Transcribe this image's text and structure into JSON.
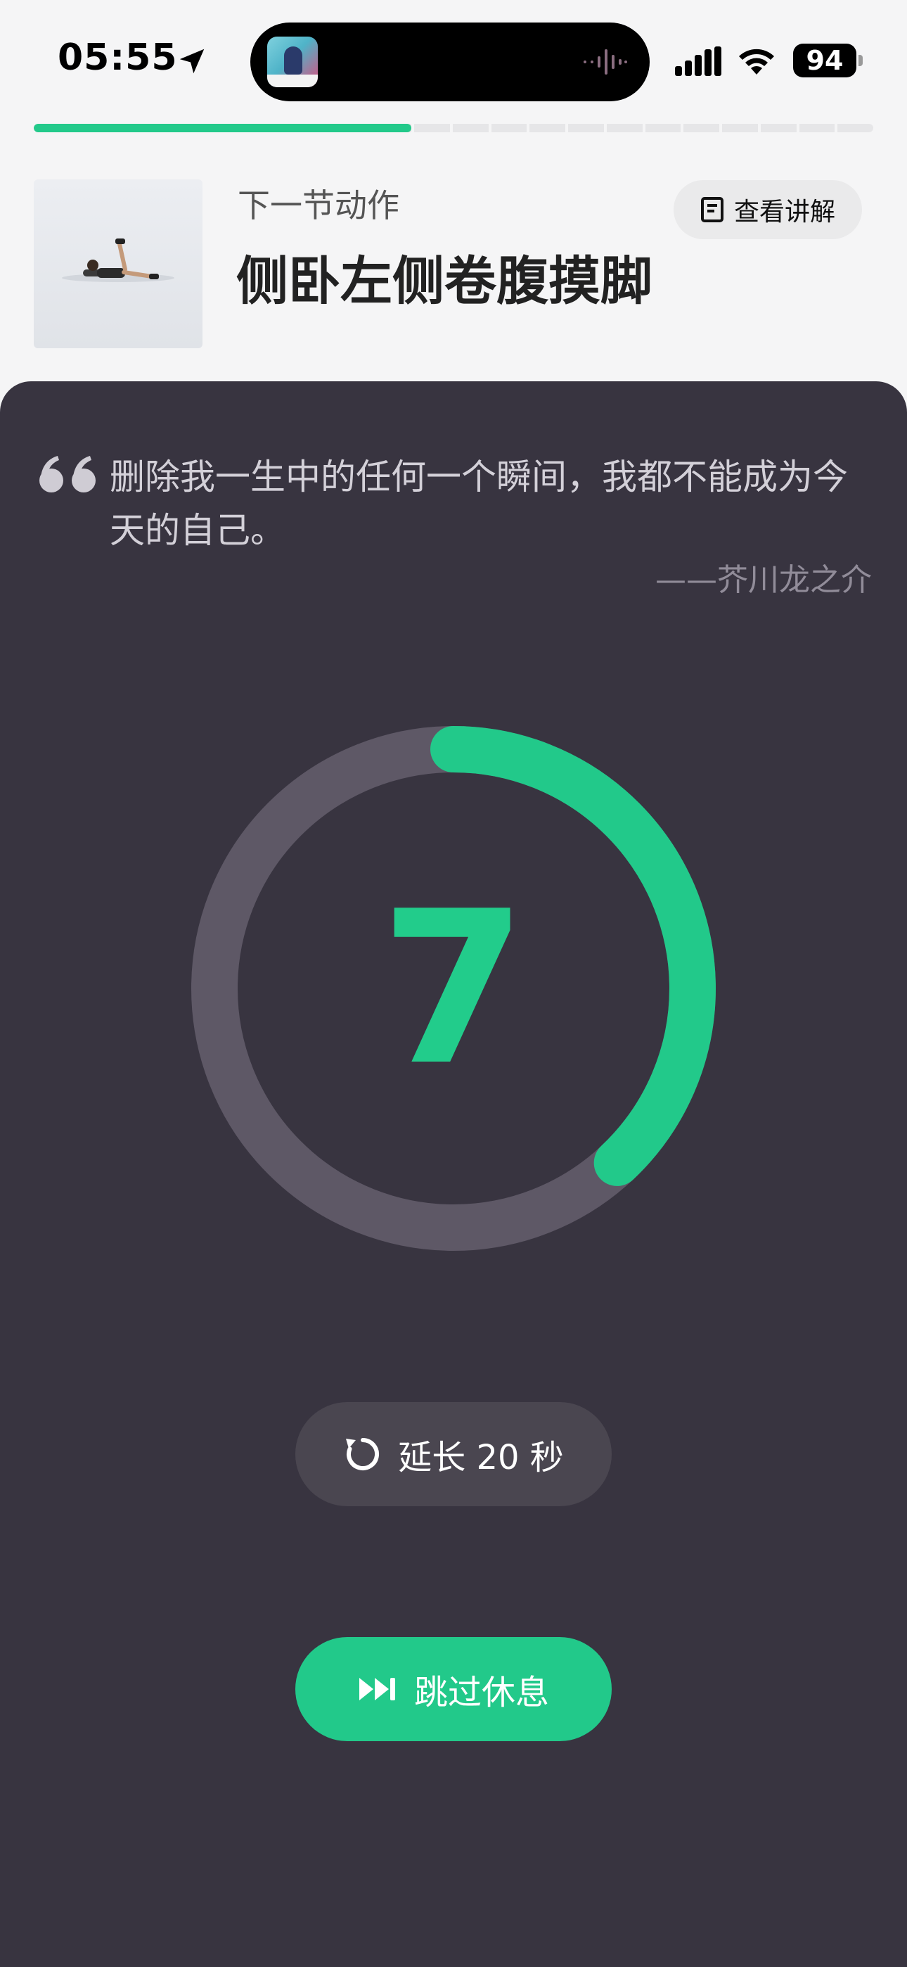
{
  "status_bar": {
    "time": "05:55",
    "battery": "94",
    "icons": [
      "location-arrow-icon",
      "sound-wave-icon",
      "cellular-signal-icon",
      "wifi-icon"
    ]
  },
  "progress": {
    "completed_fraction": 0.45,
    "segments": 12
  },
  "next_exercise": {
    "label": "下一节动作",
    "name": "侧卧左侧卷腹摸脚",
    "explain_button": "查看讲解"
  },
  "quote": {
    "text": "删除我一生中的任何一个瞬间，我都不能成为今天的自己。",
    "author": "——芥川龙之介"
  },
  "timer": {
    "value": "7",
    "remaining_fraction": 0.38
  },
  "buttons": {
    "extend": "延长 20 秒",
    "skip": "跳过休息"
  },
  "colors": {
    "accent": "#22C98A",
    "panel": "#383440",
    "ring_track": "#5E5866"
  }
}
